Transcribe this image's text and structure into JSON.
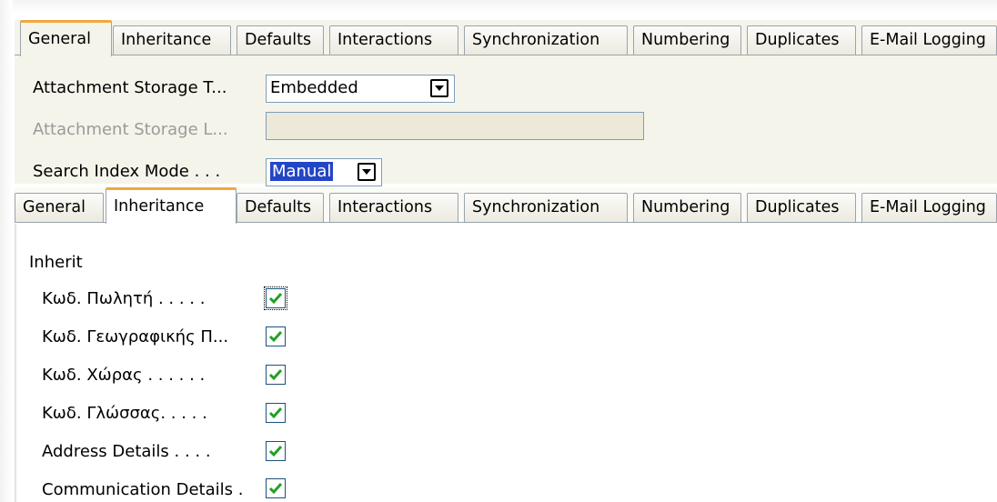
{
  "top_panel": {
    "tabs": [
      "General",
      "Inheritance",
      "Defaults",
      "Interactions",
      "Synchronization",
      "Numbering",
      "Duplicates",
      "E-Mail Logging"
    ],
    "active_tab": "General",
    "fields": {
      "attachment_storage_type": {
        "label": "Attachment Storage T...",
        "value": "Embedded"
      },
      "attachment_storage_location": {
        "label": "Attachment Storage L...",
        "value": ""
      },
      "search_index_mode": {
        "label": "Search Index Mode . . .",
        "value": "Manual"
      }
    }
  },
  "bottom_panel": {
    "tabs": [
      "General",
      "Inheritance",
      "Defaults",
      "Interactions",
      "Synchronization",
      "Numbering",
      "Duplicates",
      "E-Mail Logging"
    ],
    "active_tab": "Inheritance",
    "group_label": "Inherit",
    "checkboxes": [
      {
        "label": "Κωδ. Πωλητή . . . . .",
        "checked": true
      },
      {
        "label": "Κωδ. Γεωγραφικής Π...",
        "checked": true
      },
      {
        "label": "Κωδ. Χώρας . . . . . .",
        "checked": true
      },
      {
        "label": "Κωδ. Γλώσσας. . . . .",
        "checked": true
      },
      {
        "label": "Address Details . . . .",
        "checked": true
      },
      {
        "label": "Communication Details .",
        "checked": true
      }
    ]
  },
  "colors": {
    "tab_accent": "#f1a83c",
    "panel_bg": "#f5f4ea",
    "selection": "#2346c6",
    "check": "#21a121"
  }
}
